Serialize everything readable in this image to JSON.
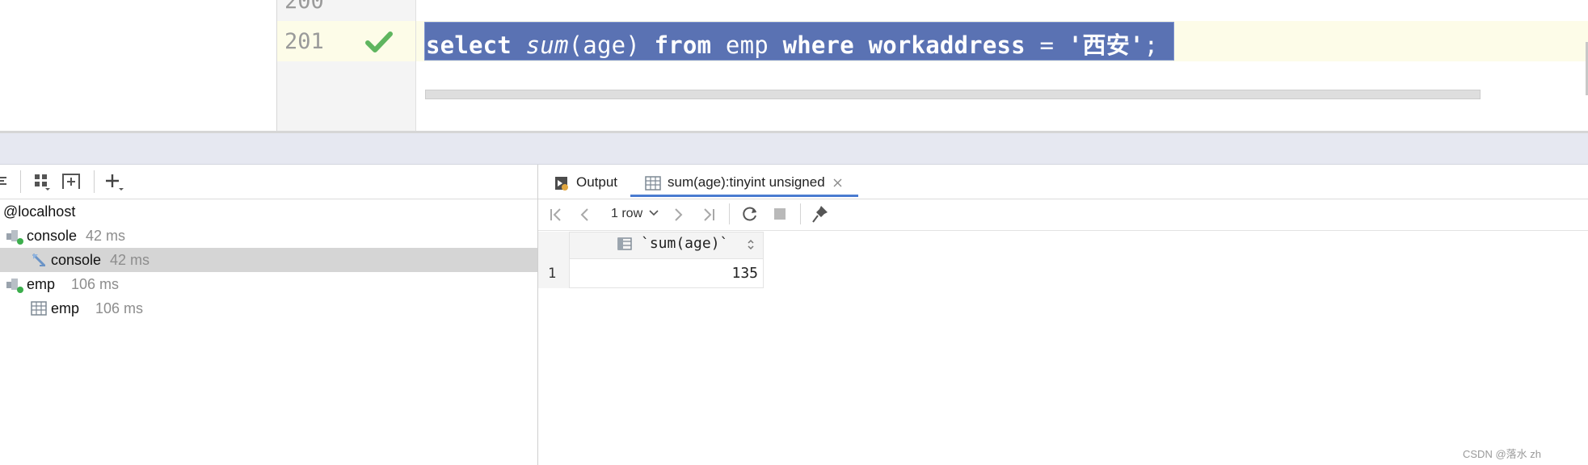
{
  "editor": {
    "line_prev": "200",
    "line_current": "201",
    "sql": {
      "kw_select": "select",
      "fn_sum": "sum",
      "paren_age": "(age)",
      "kw_from": "from",
      "table": "emp",
      "kw_where": "where",
      "column": "workaddress",
      "op": "=",
      "literal": "'西安'",
      "terminator": ";"
    },
    "selection_color": "#5a72b3",
    "current_line_bg": "#fdfce8",
    "status_icon": "check-icon"
  },
  "services": {
    "root": "@localhost",
    "tree": [
      {
        "label": "console",
        "time": "42 ms",
        "icon": "session-icon"
      },
      {
        "label": "console",
        "time": "42 ms",
        "icon": "query-icon",
        "selected": true
      },
      {
        "label": "emp",
        "time": "106 ms",
        "icon": "session-icon"
      },
      {
        "label": "emp",
        "time": "106 ms",
        "icon": "table-icon"
      }
    ]
  },
  "results": {
    "tabs": [
      {
        "label": "Output",
        "icon": "output-icon"
      },
      {
        "label": "sum(age):tinyint unsigned",
        "icon": "table-icon",
        "active": true,
        "close_icon": "close-icon"
      }
    ],
    "row_count_label": "1 row",
    "grid": {
      "columns": [
        "`sum(age)`"
      ],
      "rows": [
        {
          "num": "1",
          "values": [
            "135"
          ]
        }
      ]
    }
  },
  "watermark": "CSDN @落水 zh"
}
